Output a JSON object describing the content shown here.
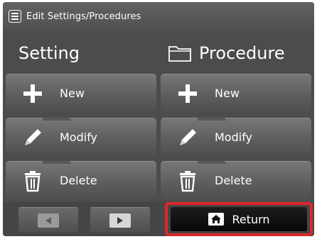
{
  "window": {
    "title": "Edit Settings/Procedures",
    "icon": "list-icon"
  },
  "columns": {
    "setting": {
      "header": "Setting",
      "buttons": [
        {
          "label": "New",
          "icon": "plus-icon"
        },
        {
          "label": "Modify",
          "icon": "pencil-icon"
        },
        {
          "label": "Delete",
          "icon": "trash-icon"
        }
      ]
    },
    "procedure": {
      "header": "Procedure",
      "header_icon": "folder-icon",
      "buttons": [
        {
          "label": "New",
          "icon": "plus-icon"
        },
        {
          "label": "Modify",
          "icon": "pencil-icon"
        },
        {
          "label": "Delete",
          "icon": "trash-icon"
        }
      ]
    }
  },
  "footer": {
    "prev_icon": "triangle-left-icon",
    "next_icon": "triangle-right-icon",
    "return_label": "Return",
    "return_icon": "home-icon"
  },
  "colors": {
    "highlight": "#e0262a",
    "panel": "#4c4c4c",
    "return_button": "#0b0b0b"
  }
}
